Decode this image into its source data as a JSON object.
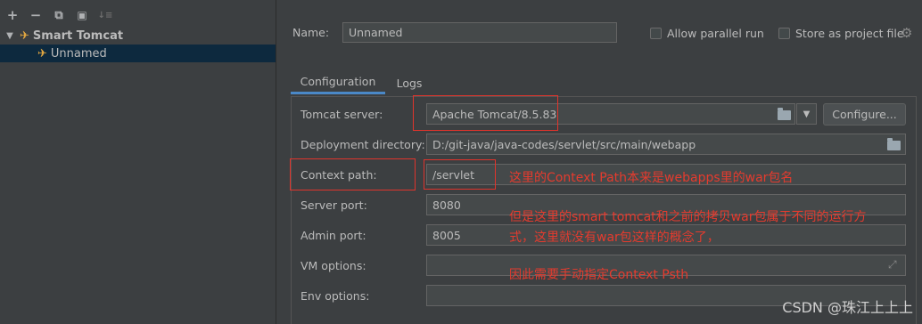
{
  "left_panel": {
    "toolbar": {
      "add": "+",
      "remove": "−",
      "copy": "⧉",
      "add_folder": "▣",
      "sort": "↓≡"
    },
    "tree": [
      {
        "label": "Smart Tomcat",
        "expanded": true
      },
      {
        "label": "Unnamed",
        "selected": true
      }
    ]
  },
  "header": {
    "name_label": "Name:",
    "name_value": "Unnamed",
    "parallel_label": "Allow parallel run",
    "store_label": "Store as project file"
  },
  "tabs": [
    {
      "label": "Configuration",
      "active": true
    },
    {
      "label": "Logs",
      "active": false
    }
  ],
  "form": {
    "tomcat_server_label": "Tomcat server:",
    "tomcat_server_value": "Apache Tomcat/8.5.83",
    "configure_button": "Configure...",
    "deployment_dir_label": "Deployment directory:",
    "deployment_dir_value": "D:/git-java/java-codes/servlet/src/main/webapp",
    "context_path_label": "Context path:",
    "context_path_value": "/servlet",
    "server_port_label": "Server port:",
    "server_port_value": "8080",
    "admin_port_label": "Admin port:",
    "admin_port_value": "8005",
    "vm_options_label": "VM options:",
    "vm_options_value": "",
    "env_options_label": "Env options:",
    "env_options_value": ""
  },
  "annotations": {
    "line1": "这里的Context Path本来是webapps里的war包名",
    "line2": "但是这里的smart tomcat和之前的拷贝war包属于不同的运行方",
    "line3": "式，这里就没有war包这样的概念了，",
    "line4": "因此需要手动指定Context Psth"
  },
  "watermark": "CSDN @珠江上上上",
  "colors": {
    "accent": "#4a88c7",
    "annotation_red": "#e53b2e",
    "selection": "#0d293e"
  }
}
